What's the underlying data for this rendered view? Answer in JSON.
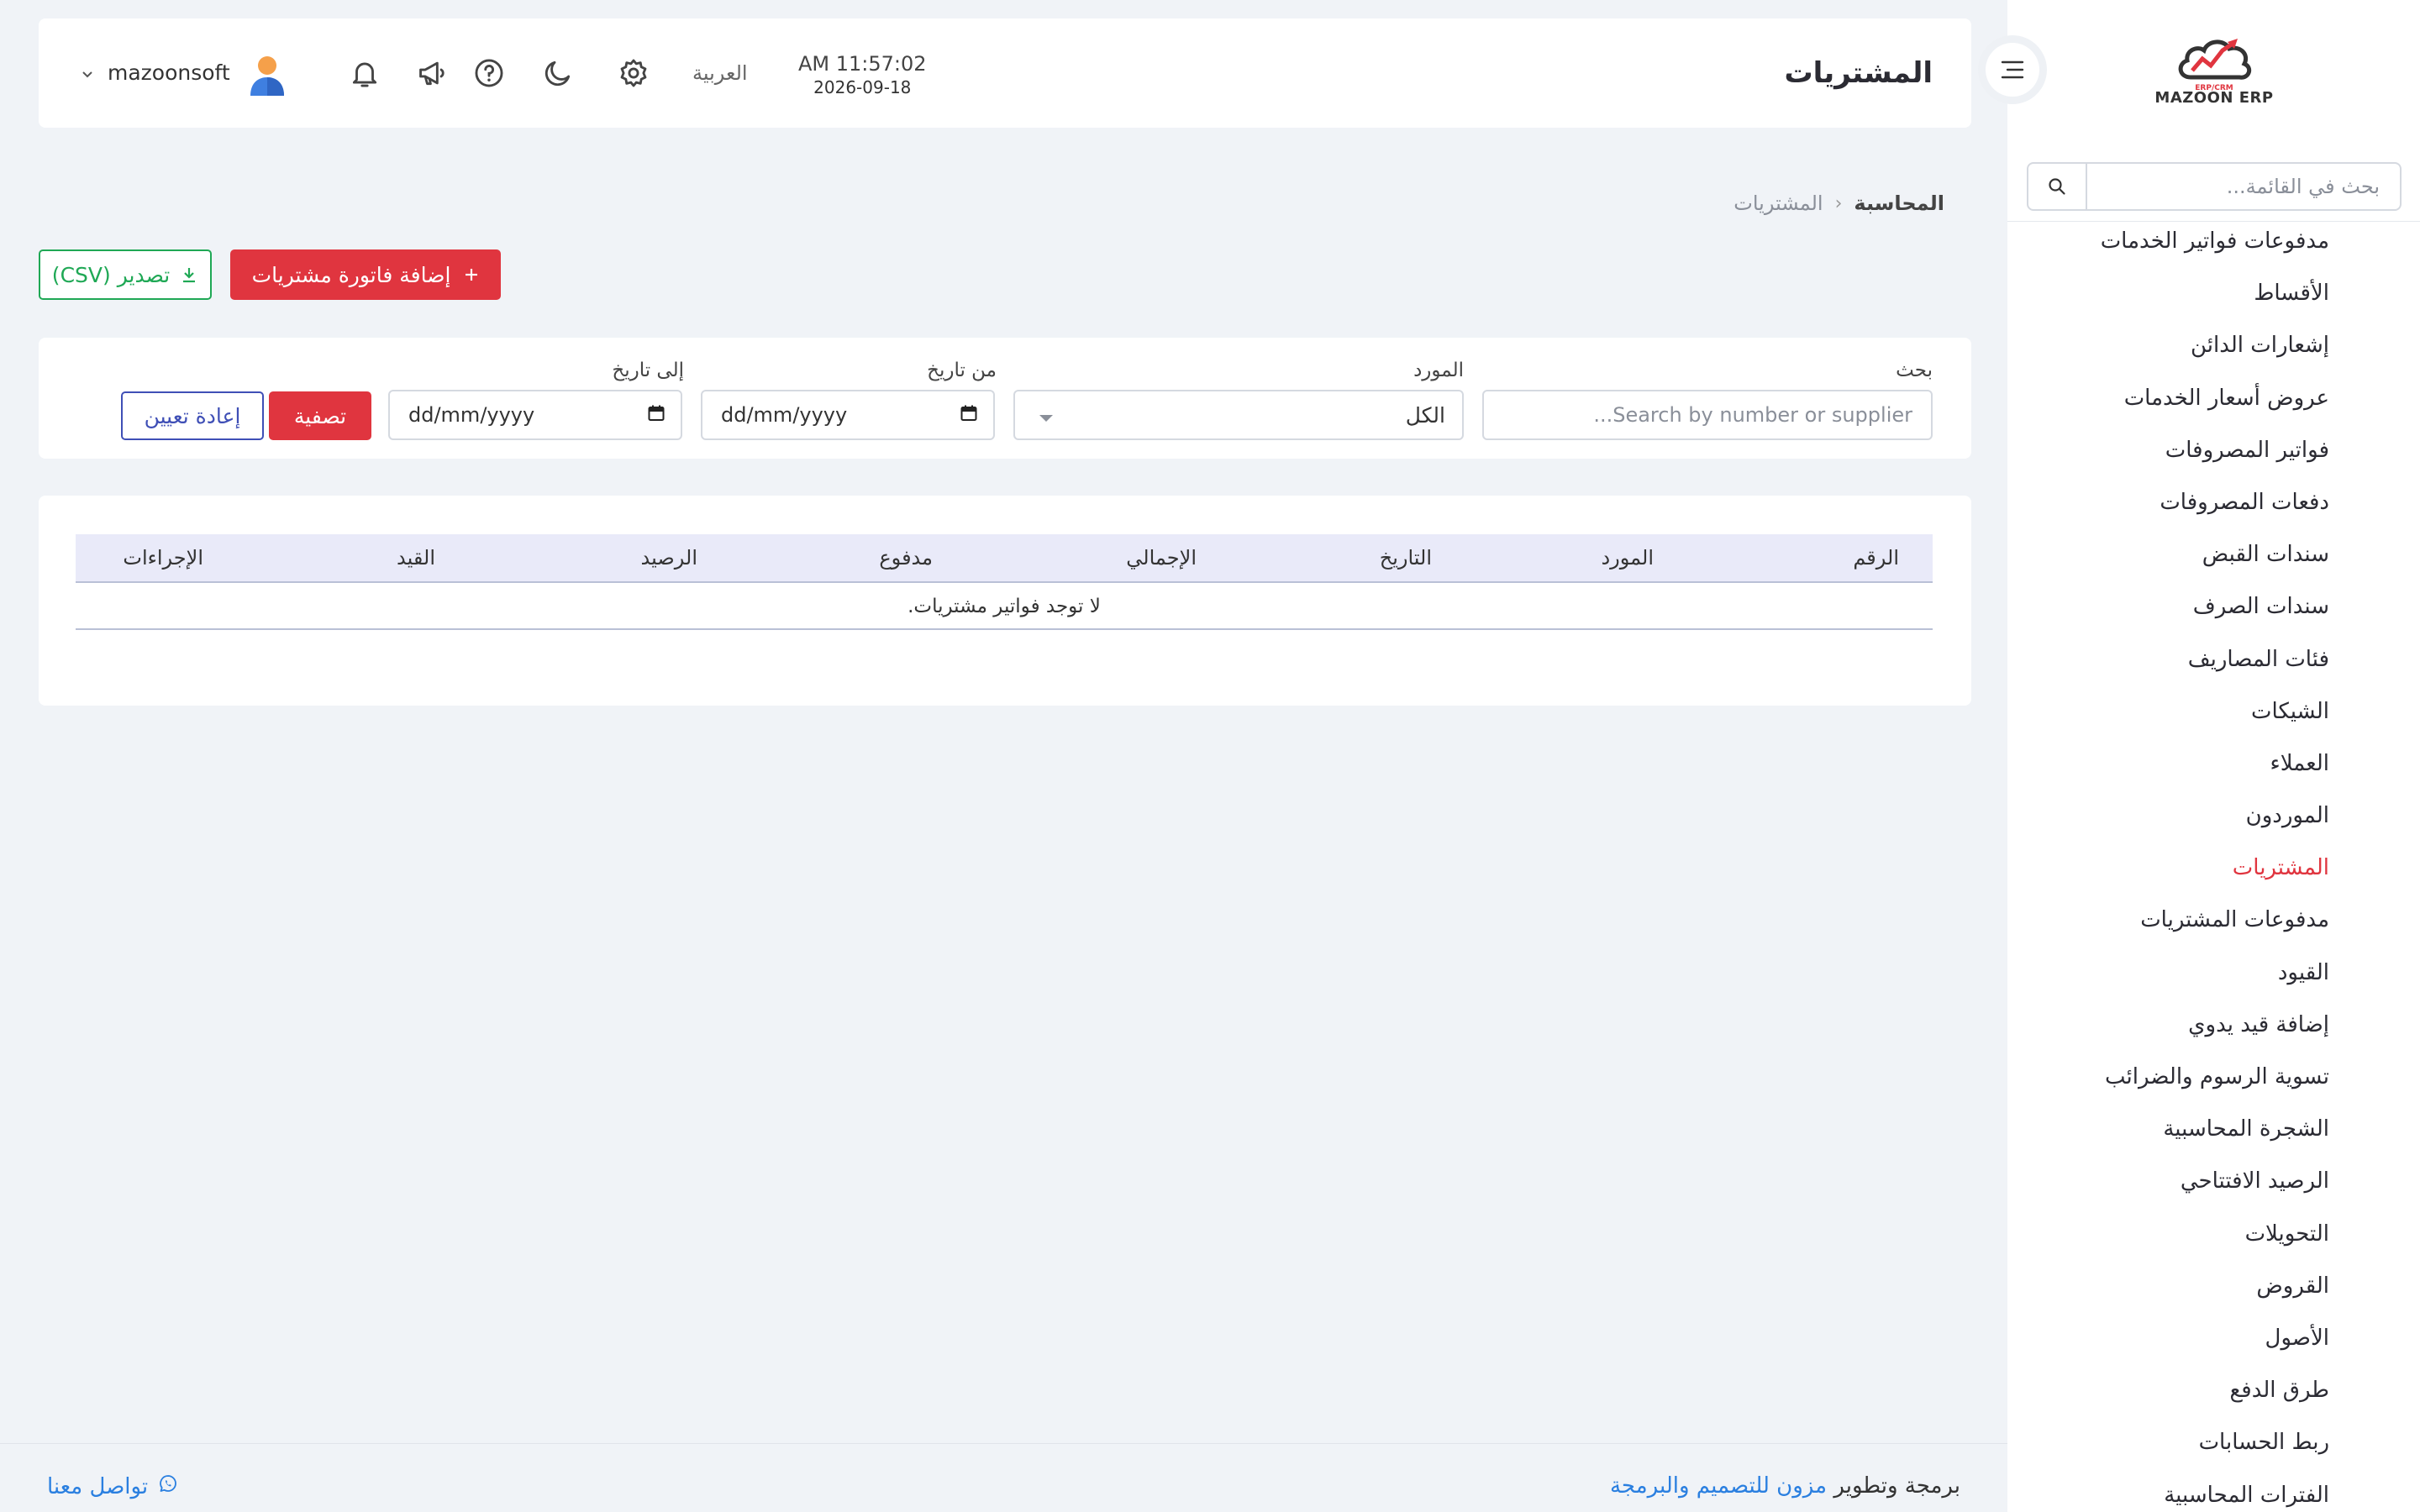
{
  "brand": {
    "name": "MAZOON ERP",
    "tagline": "ERP/CRM"
  },
  "sidebar": {
    "search_placeholder": "بحث في القائمة...",
    "items": [
      {
        "label": "مدفوعات فواتير الخدمات",
        "active": false
      },
      {
        "label": "الأقساط",
        "active": false
      },
      {
        "label": "إشعارات الدائن",
        "active": false
      },
      {
        "label": "عروض أسعار الخدمات",
        "active": false
      },
      {
        "label": "فواتير المصروفات",
        "active": false
      },
      {
        "label": "دفعات المصروفات",
        "active": false
      },
      {
        "label": "سندات القبض",
        "active": false
      },
      {
        "label": "سندات الصرف",
        "active": false
      },
      {
        "label": "فئات المصاريف",
        "active": false
      },
      {
        "label": "الشيكات",
        "active": false
      },
      {
        "label": "العملاء",
        "active": false
      },
      {
        "label": "الموردون",
        "active": false
      },
      {
        "label": "المشتريات",
        "active": true
      },
      {
        "label": "مدفوعات المشتريات",
        "active": false
      },
      {
        "label": "القيود",
        "active": false
      },
      {
        "label": "إضافة قيد يدوي",
        "active": false
      },
      {
        "label": "تسوية الرسوم والضرائب",
        "active": false
      },
      {
        "label": "الشجرة المحاسبية",
        "active": false
      },
      {
        "label": "الرصيد الافتتاحي",
        "active": false
      },
      {
        "label": "التحويلات",
        "active": false
      },
      {
        "label": "القروض",
        "active": false
      },
      {
        "label": "الأصول",
        "active": false
      },
      {
        "label": "طرق الدفع",
        "active": false
      },
      {
        "label": "ربط الحسابات",
        "active": false
      },
      {
        "label": "الفترات المحاسبية",
        "active": false
      }
    ]
  },
  "header": {
    "title": "المشتريات",
    "time": "AM 11:57:02",
    "date": "2026-09-18",
    "language": "العربية",
    "username": "mazoonsoft",
    "icons": [
      "settings-icon",
      "moon-icon",
      "help-icon",
      "megaphone-icon",
      "bell-icon"
    ]
  },
  "breadcrumb": {
    "parent": "المحاسبة",
    "current": "المشتريات"
  },
  "actions": {
    "add_label": "إضافة فاتورة مشتريات",
    "export_label": "تصدير (CSV)"
  },
  "filters": {
    "search_label": "بحث",
    "search_placeholder": "Search by number or supplier...",
    "supplier_label": "المورد",
    "supplier_value": "الكل",
    "from_label": "من تاريخ",
    "to_label": "إلى تاريخ",
    "date_placeholder": "dd/mm/yyyy",
    "filter_button": "تصفية",
    "reset_button": "إعادة تعيين"
  },
  "table": {
    "columns": [
      "الرقم",
      "المورد",
      "التاريخ",
      "الإجمالي",
      "مدفوع",
      "الرصيد",
      "القيد",
      "الإجراءات"
    ],
    "empty_message": "لا توجد فواتير مشتريات."
  },
  "footer": {
    "credit_prefix": "برمجة وتطوير",
    "credit_link": "مزون للتصميم والبرمجة",
    "contact": "تواصل معنا"
  },
  "colors": {
    "accent": "#e0353f",
    "success": "#1fa855",
    "link": "#2a7fe0",
    "outline": "#3f4fb6"
  }
}
